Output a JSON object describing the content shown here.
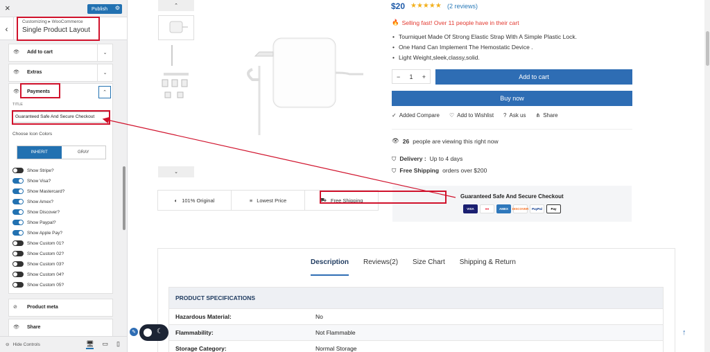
{
  "sidebar": {
    "close_icon": "×",
    "publish_label": "Publish",
    "breadcrumb": "Customizing ▸ WooCommerce",
    "title": "Single Product Layout",
    "sections": {
      "add_to_cart": "Add to cart",
      "extras": "Extras",
      "payments": "Payments",
      "product_meta": "Product meta",
      "share": "Share"
    },
    "payments": {
      "title_label": "TITLE",
      "title_value": "Guaranteed Safe And Secure Checkout",
      "choose_icon_colors": "Choose Icon Colors",
      "color_options": [
        "INHERIT",
        "GRAY"
      ],
      "toggles": [
        {
          "label": "Show Stripe?",
          "on": false
        },
        {
          "label": "Show Visa?",
          "on": true
        },
        {
          "label": "Show Mastercard?",
          "on": true
        },
        {
          "label": "Show Amex?",
          "on": true
        },
        {
          "label": "Show Discover?",
          "on": true
        },
        {
          "label": "Show Paypal?",
          "on": true
        },
        {
          "label": "Show Apple Pay?",
          "on": true
        },
        {
          "label": "Show Custom 01?",
          "on": false
        },
        {
          "label": "Show Custom 02?",
          "on": false
        },
        {
          "label": "Show Custom 03?",
          "on": false
        },
        {
          "label": "Show Custom 04?",
          "on": false
        },
        {
          "label": "Show Custom 05?",
          "on": false
        }
      ]
    },
    "footer": {
      "hide_controls": "Hide Controls"
    }
  },
  "product": {
    "price": "$20",
    "stars": "★★★★★",
    "reviews": "(2 reviews)",
    "selling_fast": "Selling fast! Over 11 people have in their cart",
    "bullets": [
      "Tourniquet Made Of Strong Elastic Strap With A Simple Plastic Lock.",
      "One Hand Can Implement The Hemostatic Device .",
      "Light Weight,sleek,classy,solid."
    ],
    "quantity": "1",
    "qty_minus": "−",
    "qty_plus": "+",
    "add_to_cart": "Add to cart",
    "buy_now": "Buy now",
    "actions": [
      "Added Compare",
      "Add to Wishlist",
      "Ask us",
      "Share"
    ],
    "viewing_count": "26",
    "viewing_text": "people are viewing this right now",
    "delivery_label": "Delivery :",
    "delivery_value": "Up to 4 days",
    "shipping_label": "Free Shipping",
    "shipping_value": "orders over $200",
    "features": [
      "101% Original",
      "Lowest Price",
      "Free Shipping"
    ],
    "trust_title": "Guaranteed Safe And Secure Checkout",
    "cards": [
      "VISA",
      "MC",
      "AMEX",
      "DISCOVER",
      "PayPal",
      "Pay"
    ],
    "tabs": [
      "Description",
      "Reviews(2)",
      "Size Chart",
      "Shipping & Return"
    ],
    "spec_title": "PRODUCT SPECIFICATIONS",
    "specs": [
      {
        "key": "Hazardous Material:",
        "value": "No"
      },
      {
        "key": "Flammability:",
        "value": "Not Flammable"
      },
      {
        "key": "Storage Category:",
        "value": "Normal Storage"
      }
    ]
  },
  "colors": {
    "accent": "#2271b1",
    "button_blue": "#2e6db4",
    "highlight_red": "#d0112b",
    "star": "#f2b01e",
    "selling": "#e2372e"
  }
}
